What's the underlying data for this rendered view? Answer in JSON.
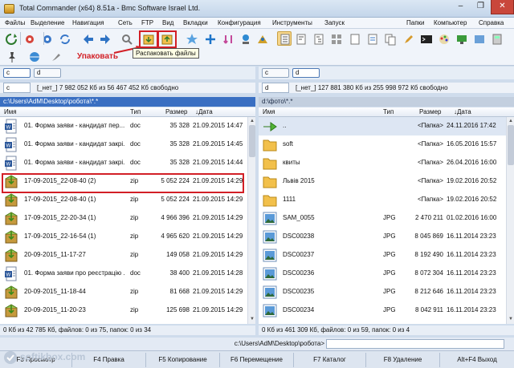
{
  "window": {
    "title": "Total Commander (x64) 8.51a - Bmc Software Israel Ltd.",
    "min": "–",
    "max": "❐",
    "close": "✕"
  },
  "menu": [
    "Файлы",
    "Выделение",
    "Навигация",
    "Сеть",
    "FTP",
    "Вид",
    "Вкладки",
    "Конфигурация",
    "Инструменты",
    "Запуск",
    "Папки",
    "Компьютер",
    "Справка"
  ],
  "annotation": {
    "label": "Упаковать",
    "tooltip": "Распаковать файлы",
    "accent": "#d21f26"
  },
  "left": {
    "drive": "c",
    "drive2": "d",
    "free": "[_нет_]  7 982 052 Кб из 56 467 452 Кб свободно",
    "path": "c:\\Users\\AdM\\Desktop\\робота\\*.*",
    "columns": {
      "name": "Имя",
      "type": "Тип",
      "size": "Размер",
      "date": "↓Дата"
    },
    "rows": [
      {
        "icon": "word",
        "name": "01. Форма заяви - кандидат пер...",
        "type": "doc",
        "size": "35 328",
        "date": "21.09.2015 14:47"
      },
      {
        "icon": "word",
        "name": "01. Форма заяви - кандидат закрі...",
        "type": "doc",
        "size": "35 328",
        "date": "21.09.2015 14:45"
      },
      {
        "icon": "word",
        "name": "01. Форма заяви - кандидат закрі...",
        "type": "doc",
        "size": "35 328",
        "date": "21.09.2015 14:44"
      },
      {
        "icon": "zip",
        "name": "17-09-2015_22-08-40 (2)",
        "type": "zip",
        "size": "5 052 224",
        "date": "21.09.2015 14:29"
      },
      {
        "icon": "zip",
        "name": "17-09-2015_22-08-40 (1)",
        "type": "zip",
        "size": "5 052 224",
        "date": "21.09.2015 14:29"
      },
      {
        "icon": "zip",
        "name": "17-09-2015_22-20-34 (1)",
        "type": "zip",
        "size": "4 966 396",
        "date": "21.09.2015 14:29"
      },
      {
        "icon": "zip",
        "name": "17-09-2015_22-16-54 (1)",
        "type": "zip",
        "size": "4 965 620",
        "date": "21.09.2015 14:29"
      },
      {
        "icon": "zip",
        "name": "20-09-2015_11-17-27",
        "type": "zip",
        "size": "149 058",
        "date": "21.09.2015 14:29"
      },
      {
        "icon": "word",
        "name": "01. Форма заяви про реєстрацію ...",
        "type": "doc",
        "size": "38 400",
        "date": "21.09.2015 14:28"
      },
      {
        "icon": "zip",
        "name": "20-09-2015_11-18-44",
        "type": "zip",
        "size": "81 668",
        "date": "21.09.2015 14:29"
      },
      {
        "icon": "zip",
        "name": "20-09-2015_11-20-23",
        "type": "zip",
        "size": "125 698",
        "date": "21.09.2015 14:29"
      }
    ],
    "status": "0 Кб из 42 785 Кб, файлов: 0 из 75, папок: 0 из 34"
  },
  "right": {
    "drive": "c",
    "drive2": "d",
    "free": "[_нет_]  127 881 380 Кб из 255 998 972 Кб свободно",
    "path": "d:\\фото\\*.*",
    "columns": {
      "name": "Имя",
      "type": "Тип",
      "size": "Размер",
      "date": "↓Дата"
    },
    "rows": [
      {
        "icon": "up",
        "name": "..",
        "type": "",
        "size": "<Папка>",
        "date": "24.11.2016 17:42"
      },
      {
        "icon": "folder",
        "name": "soft",
        "type": "",
        "size": "<Папка>",
        "date": "16.05.2016 15:57"
      },
      {
        "icon": "folder",
        "name": "квиты",
        "type": "",
        "size": "<Папка>",
        "date": "26.04.2016 16:00"
      },
      {
        "icon": "folder",
        "name": "Львів 2015",
        "type": "",
        "size": "<Папка>",
        "date": "19.02.2016 20:52"
      },
      {
        "icon": "folder",
        "name": "1111",
        "type": "",
        "size": "<Папка>",
        "date": "19.02.2016 20:52"
      },
      {
        "icon": "img",
        "name": "SAM_0055",
        "type": "JPG",
        "size": "2 470 211",
        "date": "01.02.2016 16:00"
      },
      {
        "icon": "img",
        "name": "DSC00238",
        "type": "JPG",
        "size": "8 045 869",
        "date": "16.11.2014 23:23"
      },
      {
        "icon": "img",
        "name": "DSC00237",
        "type": "JPG",
        "size": "8 192 490",
        "date": "16.11.2014 23:23"
      },
      {
        "icon": "img",
        "name": "DSC00236",
        "type": "JPG",
        "size": "8 072 304",
        "date": "16.11.2014 23:23"
      },
      {
        "icon": "img",
        "name": "DSC00235",
        "type": "JPG",
        "size": "8 212 646",
        "date": "16.11.2014 23:23"
      },
      {
        "icon": "img",
        "name": "DSC00234",
        "type": "JPG",
        "size": "8 042 911",
        "date": "16.11.2014 23:23"
      }
    ],
    "status": "0 Кб из 461 309 Кб, файлов: 0 из 59, папок: 0 из 4"
  },
  "cmdline": {
    "label": "c:\\Users\\AdM\\Desktop\\робота>"
  },
  "fkeys": [
    "F3 Просмотр",
    "F4 Правка",
    "F5 Копирование",
    "F6 Перемещение",
    "F7 Каталог",
    "F8 Удаление",
    "Alt+F4 Выход"
  ],
  "watermark": "softikbox.com",
  "colors": {
    "active_path": "#3a6fc2",
    "folder": "#f2c04b",
    "zip": "#7aa93a"
  }
}
